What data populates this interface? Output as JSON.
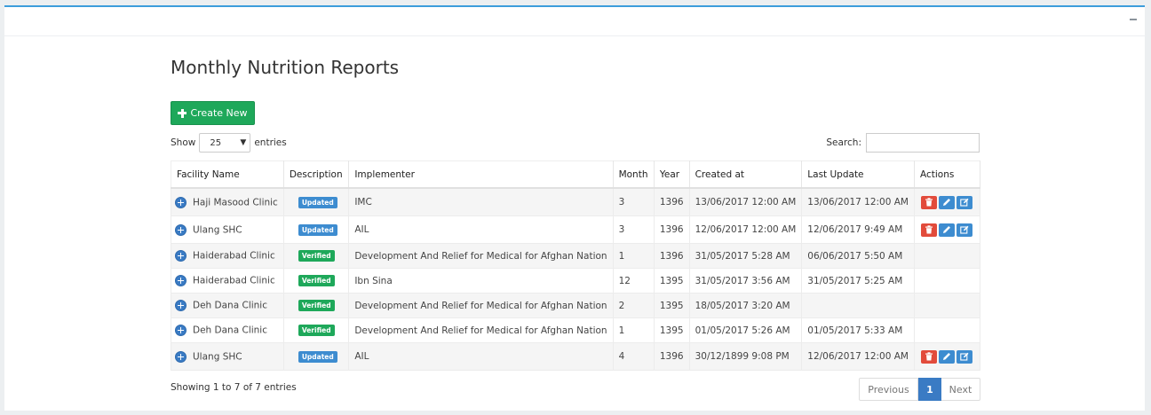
{
  "page": {
    "title": "Monthly Nutrition Reports",
    "create_button": "Create New"
  },
  "length": {
    "prefix": "Show",
    "value": "25",
    "suffix": "entries"
  },
  "search": {
    "label": "Search:",
    "value": ""
  },
  "table": {
    "columns": [
      "Facility Name",
      "Description",
      "Implementer",
      "Month",
      "Year",
      "Created at",
      "Last Update",
      "Actions"
    ],
    "rows": [
      {
        "facility": "Haji Masood Clinic",
        "status": "Updated",
        "implementer": "IMC",
        "month": "3",
        "year": "1396",
        "created": "13/06/2017 12:00 AM",
        "updated": "13/06/2017 12:00 AM",
        "actions": true
      },
      {
        "facility": "Ulang SHC",
        "status": "Updated",
        "implementer": "AIL",
        "month": "3",
        "year": "1396",
        "created": "12/06/2017 12:00 AM",
        "updated": "12/06/2017 9:49 AM",
        "actions": true
      },
      {
        "facility": "Haiderabad Clinic",
        "status": "Verified",
        "implementer": "Development And Relief for Medical for Afghan Nation",
        "month": "1",
        "year": "1396",
        "created": "31/05/2017 5:28 AM",
        "updated": "06/06/2017 5:50 AM",
        "actions": false
      },
      {
        "facility": "Haiderabad Clinic",
        "status": "Verified",
        "implementer": "Ibn Sina",
        "month": "12",
        "year": "1395",
        "created": "31/05/2017 3:56 AM",
        "updated": "31/05/2017 5:25 AM",
        "actions": false
      },
      {
        "facility": "Deh Dana Clinic",
        "status": "Verified",
        "implementer": "Development And Relief for Medical for Afghan Nation",
        "month": "2",
        "year": "1395",
        "created": "18/05/2017 3:20 AM",
        "updated": "",
        "actions": false
      },
      {
        "facility": "Deh Dana Clinic",
        "status": "Verified",
        "implementer": "Development And Relief for Medical for Afghan Nation",
        "month": "1",
        "year": "1395",
        "created": "01/05/2017 5:26 AM",
        "updated": "01/05/2017 5:33 AM",
        "actions": false
      },
      {
        "facility": "Ulang SHC",
        "status": "Updated",
        "implementer": "AIL",
        "month": "4",
        "year": "1396",
        "created": "30/12/1899 9:08 PM",
        "updated": "12/06/2017 12:00 AM",
        "actions": true
      }
    ]
  },
  "footer": {
    "info": "Showing 1 to 7 of 7 entries",
    "previous": "Previous",
    "page": "1",
    "next": "Next"
  },
  "colors": {
    "accent": "#3c9ddb",
    "create": "#1ea85a",
    "updated_badge": "#3d8cd0",
    "verified_badge": "#1ea85a",
    "delete": "#e24b3b"
  }
}
